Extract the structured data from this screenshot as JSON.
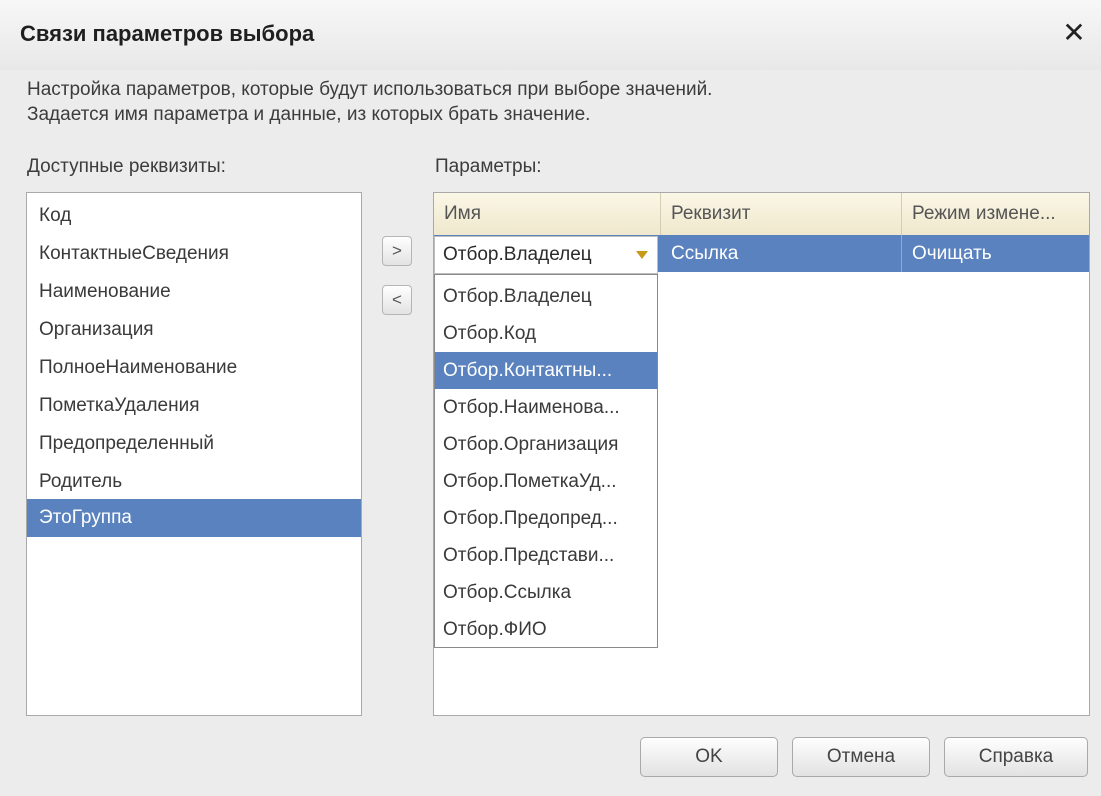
{
  "dialog": {
    "title": "Связи параметров выбора",
    "close_label": "✕",
    "description_line1": "Настройка параметров, которые будут использоваться при выборе значений.",
    "description_line2": "Задается имя параметра и данные, из которых брать значение."
  },
  "available": {
    "label": "Доступные реквизиты:",
    "items": [
      {
        "label": "Код"
      },
      {
        "label": "КонтактныеСведения"
      },
      {
        "label": "Наименование"
      },
      {
        "label": "Организация"
      },
      {
        "label": "ПолноеНаименование"
      },
      {
        "label": "ПометкаУдаления"
      },
      {
        "label": "Предопределенный"
      },
      {
        "label": "Родитель"
      },
      {
        "label": "ЭтоГруппа",
        "selected": true
      }
    ]
  },
  "move_buttons": {
    "add_label": ">",
    "remove_label": "<"
  },
  "params": {
    "label": "Параметры:",
    "columns": [
      "Имя",
      "Реквизит",
      "Режим измене..."
    ],
    "rows": [
      {
        "name": "Отбор.Владелец",
        "attribute": "Ссылка",
        "mode": "Очищать"
      }
    ],
    "dropdown_icon": "triangle-down",
    "dropdown_options": [
      "Отбор.Владелец",
      "Отбор.Код",
      "Отбор.Контактны...",
      "Отбор.Наименова...",
      "Отбор.Организация",
      "Отбор.ПометкаУд...",
      "Отбор.Предопред...",
      "Отбор.Представи...",
      "Отбор.Ссылка",
      "Отбор.ФИО"
    ],
    "dropdown_highlighted": "Отбор.Контактны..."
  },
  "buttons": {
    "ok": "OK",
    "cancel": "Отмена",
    "help": "Справка"
  },
  "colors": {
    "selection": "#5a82be",
    "header": "#f4efd9",
    "background": "#ececec"
  }
}
